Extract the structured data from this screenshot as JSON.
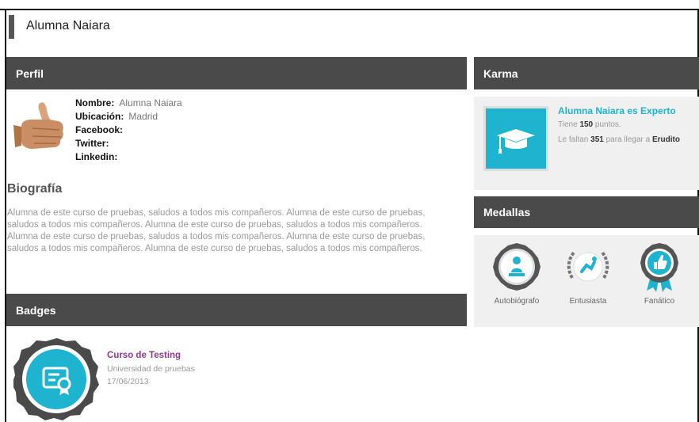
{
  "page": {
    "title": "Alumna Naiara"
  },
  "perfil": {
    "header": "Perfil",
    "fields": [
      {
        "label": "Nombre:",
        "value": "Alumna Naiara"
      },
      {
        "label": "Ubicación:",
        "value": "Madrid"
      },
      {
        "label": "Facebook:",
        "value": ""
      },
      {
        "label": "Twitter:",
        "value": ""
      },
      {
        "label": "Linkedin:",
        "value": ""
      }
    ]
  },
  "biografia": {
    "title": "Biografía",
    "text": "Alumna de este curso de pruebas, saludos a todos mis compañeros. Alumna de este curso de pruebas, saludos a todos mis compañeros. Alumna de este curso de pruebas, saludos a todos mis compañeros. Alumna de este curso de pruebas, saludos a todos mis compañeros. Alumna de este curso de pruebas, saludos a todos mis compañeros. Alumna de este curso de pruebas, saludos a todos mis compañeros."
  },
  "karma": {
    "header": "Karma",
    "title": "Alumna Naiara es Experto",
    "line1_prefix": "Tiene",
    "points": "150",
    "line1_suffix": "puntos.",
    "line2_prefix": "Le faltan",
    "missing": "351",
    "line2_middle": "para llegar a",
    "next_level": "Erudito",
    "icon": "graduation-cap-icon",
    "accent_color": "#1eb3cf"
  },
  "medallas": {
    "header": "Medallas",
    "items": [
      {
        "label": "Autobiógrafo",
        "icon": "reading-person-icon"
      },
      {
        "label": "Entusiasta",
        "icon": "laurel-runner-icon"
      },
      {
        "label": "Fanático",
        "icon": "thumbs-up-ribbon-icon"
      }
    ]
  },
  "badges": {
    "header": "Badges",
    "items": [
      {
        "title": "Curso de Testing",
        "org": "Universidad de pruebas",
        "date": "17/06/2013",
        "icon": "certificate-icon"
      }
    ]
  },
  "colors": {
    "header_bar": "#4a4a4a",
    "panel_bg": "#f0f0f0",
    "accent_cyan": "#1eb3cf",
    "badge_title": "#8b3a8f"
  }
}
